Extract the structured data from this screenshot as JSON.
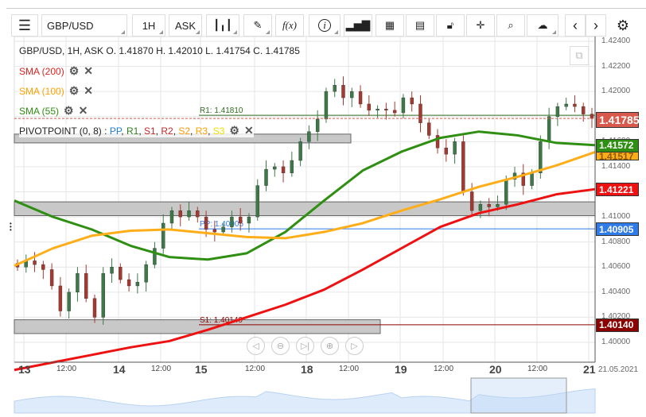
{
  "toolbar": {
    "symbol": "GBP/USD",
    "timeframe": "1H",
    "price_side": "ASK"
  },
  "legend": {
    "header": "GBP/USD, 1H, ASK   O. 1.41870 H. 1.42010 L. 1.41754 C. 1.41785",
    "sma200": "SMA (200)",
    "sma100": "SMA (100)",
    "sma55": "SMA (55)",
    "pivot": "PIVOTPOINT (0, 8)",
    "pivot_sep": " : ",
    "pivot_items": [
      {
        "t": "PP",
        "c": "#1e7be0"
      },
      {
        "t": "R1",
        "c": "#2e7d1e"
      },
      {
        "t": "S1",
        "c": "#c62828"
      },
      {
        "t": "R2",
        "c": "#c62828"
      },
      {
        "t": "S2",
        "c": "#ff9800"
      },
      {
        "t": "R3",
        "c": "#ffa000"
      },
      {
        "t": "S3",
        "c": "#f0e000"
      }
    ]
  },
  "price_labels": {
    "current": "1.41785",
    "sma55": "1.41572",
    "sma100": "1.41517",
    "sma200": "1.41221",
    "pp": "1.40905",
    "s1": "1.40140"
  },
  "colors": {
    "up": "#3b7a47",
    "down": "#a8382f",
    "sma55": "#2f8f12",
    "sma100": "#ffae1a",
    "sma200": "#ee1111",
    "pp": "#2f7be8",
    "r1": "#2e6b1e",
    "s1": "#8b0000",
    "current": "#d9594c"
  },
  "chart_data": {
    "type": "candlestick",
    "title": "GBP/USD, 1H, ASK",
    "ylim": [
      1.3992,
      1.4244
    ],
    "y_ticks": [
      "1.42400",
      "1.42200",
      "1.42000",
      "1.41800",
      "1.41600",
      "1.41400",
      "1.41200",
      "1.41000",
      "1.40800",
      "1.40600",
      "1.40400",
      "1.40200",
      "1.40000"
    ],
    "x_ticks": [
      {
        "t": "13",
        "big": true
      },
      {
        "t": "12:00"
      },
      {
        "t": "14",
        "big": true
      },
      {
        "t": "12:00"
      },
      {
        "t": "15",
        "big": true
      },
      {
        "t": "12:00"
      },
      {
        "t": "18",
        "big": true
      },
      {
        "t": "12:00"
      },
      {
        "t": "19",
        "big": true
      },
      {
        "t": "12:00"
      },
      {
        "t": "20",
        "big": true
      },
      {
        "t": "12:00"
      },
      {
        "t": "21",
        "big": true
      }
    ],
    "date_label": "21.05.2021",
    "closes": [
      1.406,
      1.4065,
      1.4062,
      1.4058,
      1.4045,
      1.4025,
      1.404,
      1.4055,
      1.4035,
      1.402,
      1.4055,
      1.406,
      1.405,
      1.4045,
      1.4048,
      1.4062,
      1.4075,
      1.4095,
      1.4105,
      1.41,
      1.4105,
      1.41,
      1.409,
      1.4088,
      1.4092,
      1.41,
      1.4095,
      1.41,
      1.4125,
      1.4138,
      1.414,
      1.4135,
      1.4145,
      1.416,
      1.4168,
      1.4178,
      1.42,
      1.4205,
      1.4195,
      1.42,
      1.419,
      1.4185,
      1.4186,
      1.4185,
      1.4183,
      1.4195,
      1.419,
      1.4175,
      1.4165,
      1.4155,
      1.415,
      1.416,
      1.412,
      1.4105,
      1.411,
      1.4108,
      1.411,
      1.413,
      1.4135,
      1.4125,
      1.4135,
      1.416,
      1.418,
      1.4188,
      1.419,
      1.4188,
      1.4182,
      1.41785
    ],
    "series": [
      {
        "name": "SMA (55)",
        "values": [
          1.4113,
          1.41,
          1.409,
          1.4077,
          1.4068,
          1.4066,
          1.4071,
          1.4088,
          1.4113,
          1.4137,
          1.4152,
          1.4163,
          1.4168,
          1.4165,
          1.4159,
          1.41572
        ]
      },
      {
        "name": "SMA (100)",
        "values": [
          1.4061,
          1.4075,
          1.4085,
          1.4089,
          1.409,
          1.4087,
          1.4084,
          1.4083,
          1.4088,
          1.4095,
          1.4105,
          1.4114,
          1.4124,
          1.4132,
          1.4141,
          1.41517
        ]
      },
      {
        "name": "SMA (200)",
        "values": [
          1.3978,
          1.3984,
          1.399,
          1.3996,
          1.4001,
          1.401,
          1.402,
          1.403,
          1.4042,
          1.4058,
          1.4075,
          1.4092,
          1.4103,
          1.411,
          1.4118,
          1.41221
        ]
      }
    ],
    "pivot_lines": [
      {
        "label": "R1: 1.41810",
        "value": 1.4181
      },
      {
        "label": "PP: 1.40905",
        "value": 1.40905
      },
      {
        "label": "S1: 1.40140",
        "value": 1.4014
      }
    ],
    "zones": [
      [
        1.4159,
        1.4166
      ],
      [
        1.4101,
        1.4112
      ],
      [
        1.4007,
        1.4018
      ]
    ]
  }
}
